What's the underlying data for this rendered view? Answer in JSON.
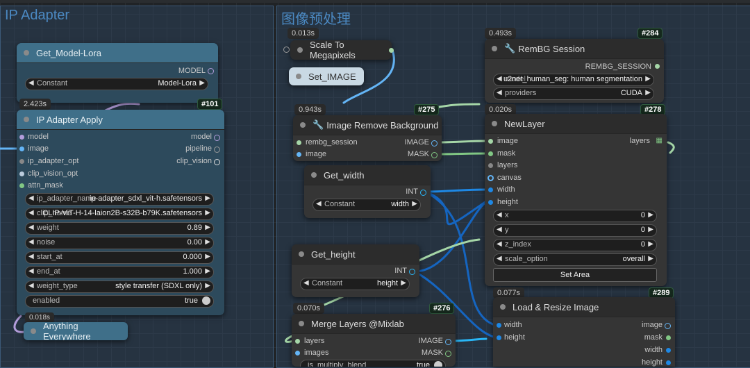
{
  "groups": {
    "ip_adapter": "IP Adapter",
    "preprocess": "图像预处理"
  },
  "get_model_lora": {
    "title": "Get_Model-Lora",
    "output": "MODEL",
    "widget_label": "Constant",
    "widget_value": "Model-Lora"
  },
  "ip_adapter_apply": {
    "timing": "2.423s",
    "badge": "#101",
    "title": "IP Adapter Apply",
    "inputs": [
      "model",
      "image",
      "ip_adapter_opt",
      "clip_vision_opt",
      "attn_mask"
    ],
    "outputs": [
      "model",
      "pipeline",
      "clip_vision"
    ],
    "widgets": [
      {
        "label": "ip_adapter_name",
        "value": "ip-adapter_sdxl_vit-h.safetensors"
      },
      {
        "label": "clip_name",
        "value": "CLIP-ViT-H-14-laion2B-s32B-b79K.safetensors"
      },
      {
        "label": "weight",
        "value": "0.89"
      },
      {
        "label": "noise",
        "value": "0.00"
      },
      {
        "label": "start_at",
        "value": "0.000"
      },
      {
        "label": "end_at",
        "value": "1.000"
      },
      {
        "label": "weight_type",
        "value": "style transfer (SDXL only)"
      }
    ],
    "enabled_label": "enabled",
    "enabled_value": "true"
  },
  "anything_everywhere": {
    "timing": "0.018s",
    "title": "Anything Everywhere"
  },
  "scale_to_megapixels": {
    "timing": "0.013s",
    "title": "Scale To Megapixels"
  },
  "set_image": {
    "title": "Set_IMAGE"
  },
  "rembg_session": {
    "timing": "0.493s",
    "badge": "#284",
    "title": "RemBG Session",
    "output": "REMBG_SESSION",
    "widget1_value": "u2net_human_seg: human segmentation",
    "widget1_overlap": "model",
    "widget2_label": "providers",
    "widget2_value": "CUDA"
  },
  "image_remove_bg": {
    "timing": "0.943s",
    "badge": "#275",
    "title": "Image Remove Background",
    "inputs": [
      "rembg_session",
      "image"
    ],
    "outputs": [
      "IMAGE",
      "MASK"
    ]
  },
  "get_width": {
    "title": "Get_width",
    "output": "INT",
    "widget_label": "Constant",
    "widget_value": "width"
  },
  "get_height": {
    "title": "Get_height",
    "output": "INT",
    "widget_label": "Constant",
    "widget_value": "height"
  },
  "new_layer": {
    "timing": "0.020s",
    "badge": "#278",
    "title": "NewLayer",
    "output": "layers",
    "inputs": [
      "image",
      "mask",
      "layers",
      "canvas",
      "width",
      "height"
    ],
    "widgets": [
      {
        "label": "x",
        "value": "0"
      },
      {
        "label": "y",
        "value": "0"
      },
      {
        "label": "z_index",
        "value": "0"
      },
      {
        "label": "scale_option",
        "value": "overall"
      }
    ],
    "button": "Set Area"
  },
  "merge_layers": {
    "timing": "0.070s",
    "badge": "#276",
    "title": "Merge Layers @Mixlab",
    "inputs": [
      "layers",
      "images"
    ],
    "outputs": [
      "IMAGE",
      "MASK"
    ],
    "widget_label": "is_multiply_blend",
    "widget_value": "true"
  },
  "load_resize": {
    "timing": "0.077s",
    "badge": "#289",
    "title": "Load & Resize Image",
    "inputs": [
      "width",
      "height"
    ],
    "outputs": [
      "image",
      "mask",
      "width",
      "height"
    ]
  },
  "colors": {
    "image": "#64b5f6",
    "mask": "#81c784",
    "model": "#b39ddb",
    "int": "#29b6f6",
    "wire_green": "#a5d6a7",
    "wire_blue": "#1e88e5"
  }
}
